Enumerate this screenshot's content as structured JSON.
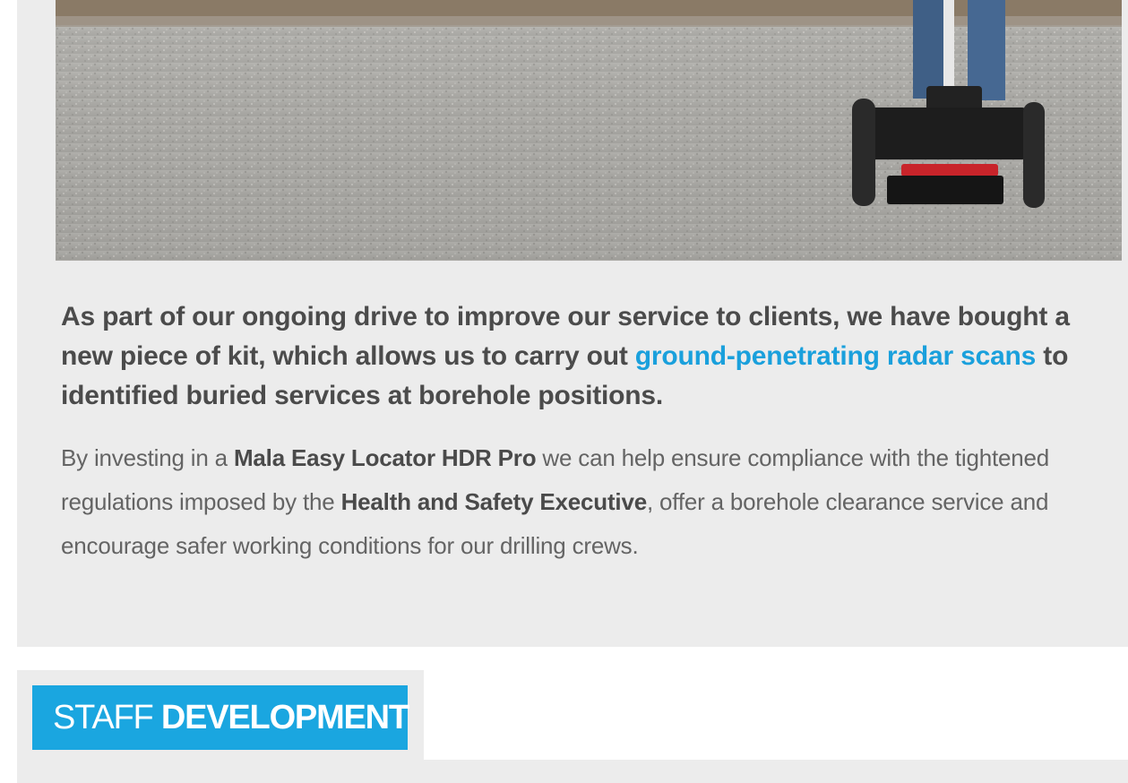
{
  "article": {
    "lead_before": "As part of our ongoing drive to improve our service to clients, we have bought a new piece of kit, which allows us to carry out ",
    "lead_link": "ground-penetrating radar scans",
    "lead_after": " to identified buried services at borehole positions.",
    "body_1": "By investing in a ",
    "body_product": "Mala Easy Locator HDR Pro",
    "body_2": " we can help ensure compliance with the tightened regulations imposed by the ",
    "body_org": "Health and Safety Executive",
    "body_3": ", offer a borehole clearance service and encourage safer working conditions for our drilling crews."
  },
  "next_section": {
    "label_light": "STAFF ",
    "label_bold": "DEVELOPMENT"
  },
  "colors": {
    "accent": "#1aa6e0",
    "link": "#1aa0dc",
    "panel": "#ececec",
    "lead_text": "#4b4b4b",
    "body_text": "#646464"
  }
}
